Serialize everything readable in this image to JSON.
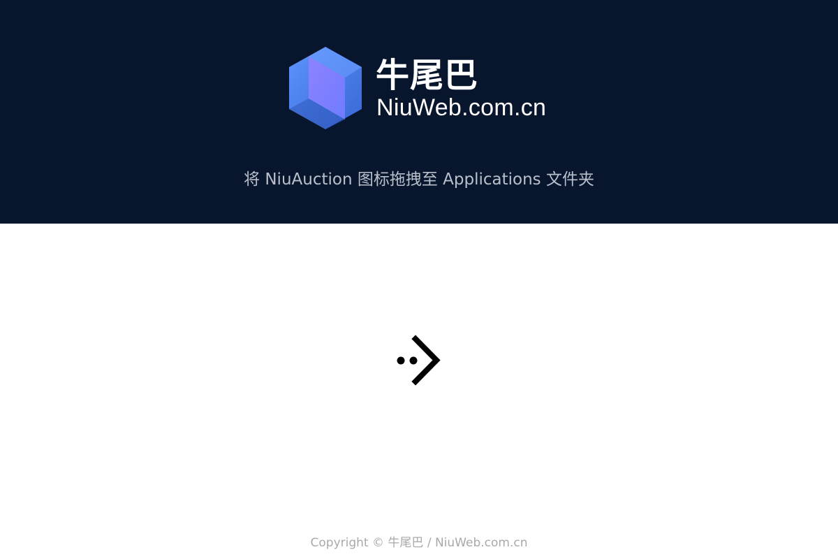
{
  "header": {
    "background_color": "#07152d",
    "logo": {
      "icon_name": "hexagon-logo-icon",
      "colors": [
        "#4f89f2",
        "#6f7cff",
        "#3a60c8"
      ]
    },
    "brand_name": "牛尾巴",
    "brand_domain": "NiuWeb.com.cn",
    "instruction": "将 NiuAuction 图标拖拽至 Applications 文件夹"
  },
  "main": {
    "arrow_icon": "arrow-right-icon",
    "arrow_color": "#000000"
  },
  "footer": {
    "copyright_label": "Copyright ©",
    "brand_name": "牛尾巴",
    "separator": "/",
    "domain": "NiuWeb.com.cn",
    "text_color": "#a9a9a9"
  }
}
